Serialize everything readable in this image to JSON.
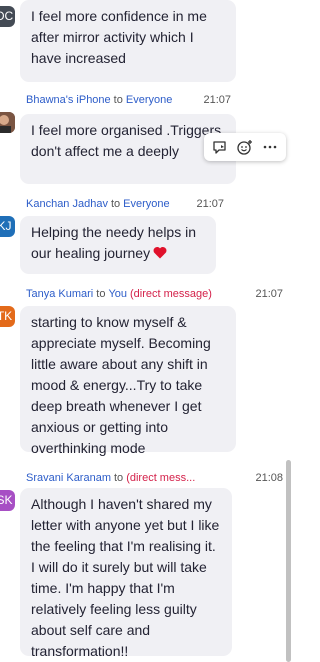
{
  "messages": [
    {
      "avatar_text": "DC",
      "avatar_color": "#444b55",
      "text": "I feel more confidence in me after mirror activity which I have increased"
    },
    {
      "sender": "Bhawna's iPhone",
      "connector": "to",
      "recipient": "Everyone",
      "time": "21:07",
      "text": "I feel more organised .Triggers don't affect me a deeply"
    },
    {
      "avatar_text": "KJ",
      "avatar_color": "#1f6fb8",
      "sender": "Kanchan Jadhav",
      "connector": "to",
      "recipient": "Everyone",
      "time": "21:07",
      "text": "Helping the needy helps in our healing journey"
    },
    {
      "avatar_text": "TK",
      "avatar_color": "#e36a1a",
      "sender": "Tanya Kumari",
      "connector": "to",
      "recipient": "You",
      "dm_label": "(direct message)",
      "time": "21:07",
      "text": "starting to know myself & appreciate myself. Becoming little aware about any shift in mood & energy...Try to take deep breath whenever I get anxious or getting into overthinking mode"
    },
    {
      "avatar_text": "SK",
      "avatar_color": "#a74fc4",
      "sender": "Sravani Karanam",
      "connector": "to",
      "recipient": "You",
      "dm_label": "(direct mess...",
      "time": "21:08",
      "text": "Although I haven't shared my letter with anyone yet but I like the feeling that I'm realising it. I will do it surely but will take time. I'm happy that I'm relatively feeling less guilty about self care and transformation!!"
    }
  ],
  "toolbar": {
    "reply_icon": "reply-icon",
    "react_icon": "add-reaction-icon",
    "more_icon": "more-icon"
  },
  "colors": {
    "name_blue": "#2d5dc9",
    "dm_red": "#d4214a",
    "bubble_bg": "#f0f0f4",
    "heart": "#e0112b"
  }
}
